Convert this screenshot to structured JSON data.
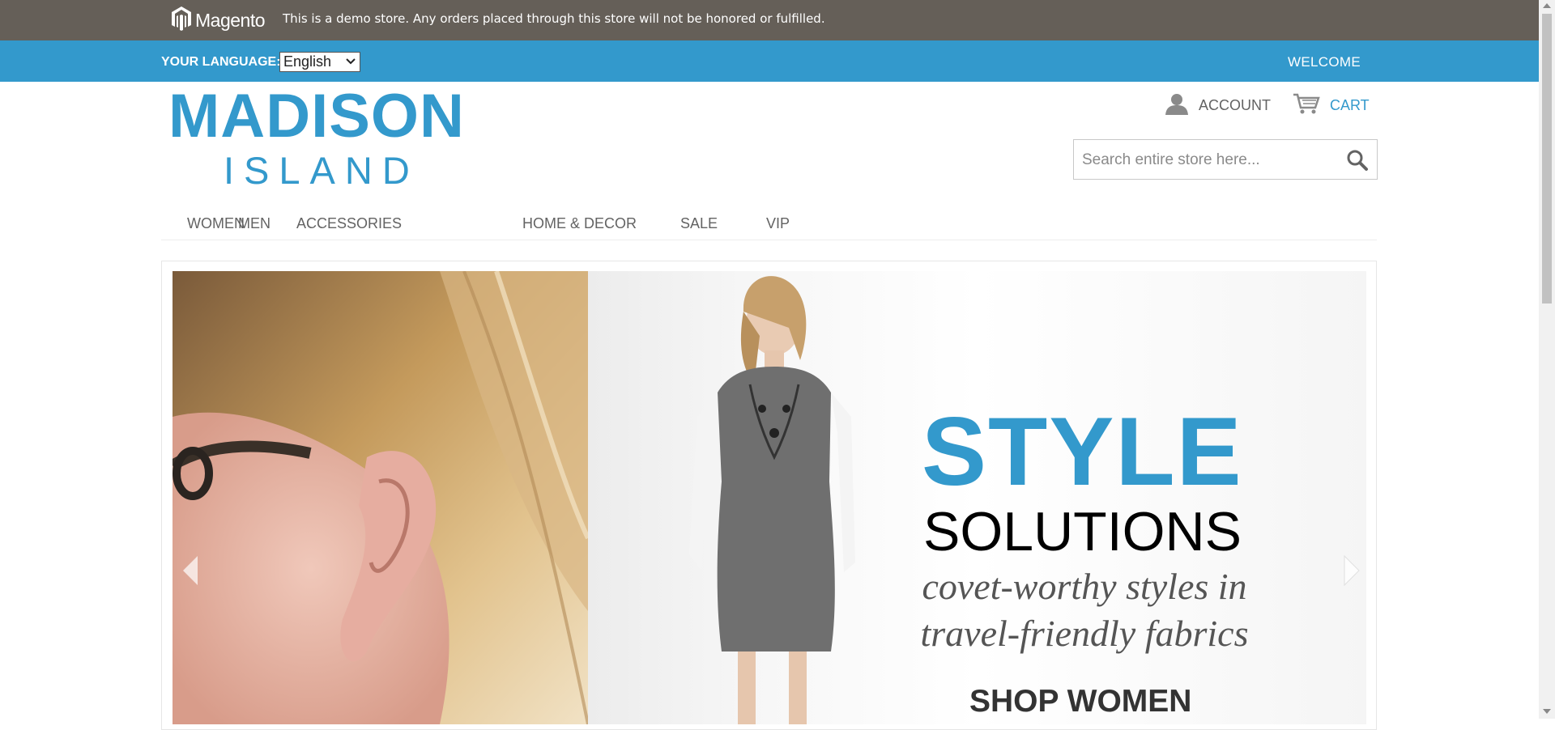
{
  "demo_notice": {
    "brand": "Magento",
    "text": "This is a demo store. Any orders placed through this store will not be honored or fulfilled."
  },
  "language_bar": {
    "label": "YOUR LANGUAGE:",
    "selected": "English",
    "welcome": "WELCOME"
  },
  "logo": {
    "line1": "MADISON",
    "line2": "ISLAND"
  },
  "header": {
    "account_label": "ACCOUNT",
    "cart_label": "CART",
    "search_placeholder": "Search entire store here..."
  },
  "nav": {
    "items": [
      {
        "label": "WOMEN"
      },
      {
        "label": "MEN"
      },
      {
        "label": "ACCESSORIES"
      },
      {
        "label": "HOME & DECOR"
      },
      {
        "label": "SALE"
      },
      {
        "label": "VIP"
      }
    ]
  },
  "slide": {
    "headline1": "STYLE",
    "headline2": "SOLUTIONS",
    "tagline_line1": "covet-worthy styles in",
    "tagline_line2": "travel-friendly fabrics",
    "cta": "SHOP WOMEN"
  },
  "colors": {
    "demo_bar": "#655f58",
    "accent": "#3399cc",
    "text": "#636363"
  },
  "icons": [
    "magento-logo-icon",
    "chevron-down-icon",
    "user-icon",
    "cart-icon",
    "search-icon",
    "arrow-left-icon",
    "arrow-right-icon"
  ]
}
